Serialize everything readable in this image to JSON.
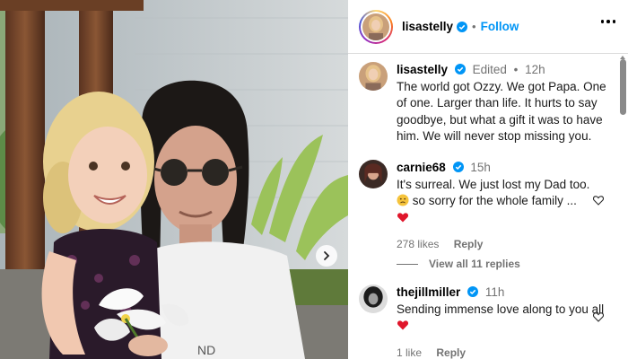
{
  "post": {
    "author": "lisastelly",
    "follow_label": "Follow",
    "separator": "•"
  },
  "caption": {
    "username": "lisastelly",
    "edited": "Edited",
    "separator": "•",
    "time": "12h",
    "text": "The world got Ozzy. We got Papa. One of one. Larger than life. It hurts to say goodbye, but what a gift it was to have him. We will never stop missing you."
  },
  "comments": [
    {
      "username": "carnie68",
      "time": "15h",
      "text_line1": "It's surreal. We just lost my Dad too.",
      "text_line2": "so sorry for the whole family ...",
      "likes": "278 likes",
      "reply_label": "Reply",
      "view_replies": "View all 11 replies"
    },
    {
      "username": "thejillmiller",
      "time": "11h",
      "text": "Sending immense love along to you all",
      "likes": "1 like",
      "reply_label": "Reply"
    }
  ],
  "icons": [
    "verified-badge-icon",
    "more-options-icon",
    "heart-icon",
    "next-arrow-icon",
    "sad-face-emoji",
    "red-heart-emoji"
  ],
  "colors": {
    "accent": "#0095f6",
    "muted": "#737373",
    "heart_red": "#e0162b"
  }
}
